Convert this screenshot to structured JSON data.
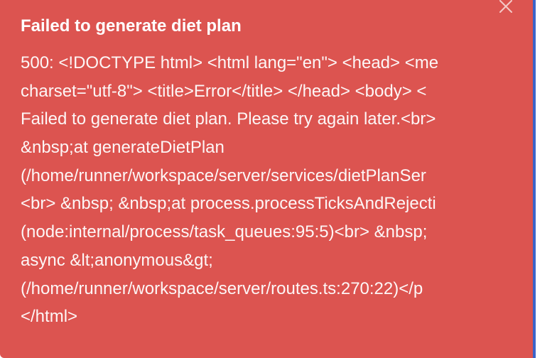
{
  "toast": {
    "title": "Failed to generate diet plan",
    "close_icon": "close-icon",
    "message_lines": [
      "500: <!DOCTYPE html> <html lang=\"en\"> <head> <me",
      "charset=\"utf-8\"> <title>Error</title> </head> <body> <",
      "Failed to generate diet plan. Please try again later.<br>",
      "&nbsp;at generateDietPlan",
      "(/home/runner/workspace/server/services/dietPlanSer",
      "<br> &nbsp; &nbsp;at process.processTicksAndRejecti",
      "(node:internal/process/task_queues:95:5)<br> &nbsp;",
      "async &lt;anonymous&gt;",
      "(/home/runner/workspace/server/routes.ts:270:22)</p",
      "</html>"
    ]
  },
  "colors": {
    "toast_background": "#dc5450",
    "text": "#ffffff",
    "edge_accent": "#3d64c8"
  }
}
